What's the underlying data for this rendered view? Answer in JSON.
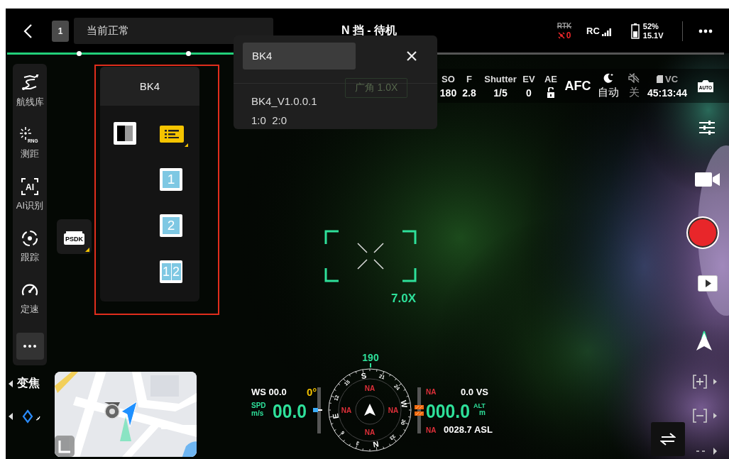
{
  "top_bar": {
    "channel": "1",
    "status": "当前正常",
    "mode": "N 挡 - 待机",
    "rtk": {
      "label": "RTK",
      "connected": false,
      "count": "0"
    },
    "rc": {
      "label": "RC"
    },
    "battery": {
      "percent": "52%",
      "voltage": "15.1V",
      "level": 0.52
    }
  },
  "mission_progress": {
    "level": 0.45
  },
  "sidebar": {
    "items": [
      {
        "kind": "route",
        "label": "航线库"
      },
      {
        "kind": "range",
        "label": "测距",
        "badge": "RNG"
      },
      {
        "kind": "ai",
        "label": "AI识别",
        "badge": "AI"
      },
      {
        "kind": "track",
        "label": "跟踪"
      },
      {
        "kind": "speed",
        "label": "定速"
      }
    ]
  },
  "psdk_button": {
    "label": "PSDK"
  },
  "bk_panel": {
    "title": "BK4",
    "options": [
      {
        "kind": "contrast",
        "selected": false
      },
      {
        "kind": "list",
        "selected": true
      },
      {
        "kind": "number",
        "labels": [
          "1"
        ],
        "selected": false
      },
      {
        "kind": "number",
        "labels": [
          "2"
        ],
        "selected": false
      },
      {
        "kind": "number",
        "labels": [
          "1",
          "2"
        ],
        "selected": false
      }
    ]
  },
  "popup": {
    "search_value": "BK4",
    "version": "BK4_V1.0.0.1",
    "channels": "1:0  2:0"
  },
  "lens_badge": "广角 1.0X",
  "camera_params": {
    "items": [
      {
        "kind": "text",
        "label": "SO",
        "value": "180"
      },
      {
        "kind": "text",
        "label": "F",
        "value": "2.8"
      },
      {
        "kind": "text",
        "label": "Shutter",
        "value": "1/5"
      },
      {
        "kind": "text",
        "label": "EV",
        "value": "0"
      },
      {
        "kind": "lock",
        "label": "AE",
        "locked": false
      }
    ],
    "focus": "AFC",
    "night": "自动",
    "mute": "关",
    "storage": {
      "label": "VC",
      "time": "45:13:44"
    },
    "camera_mode": "AUTO"
  },
  "zoom_reading": "7.0X",
  "flight": {
    "heading": "190",
    "wind": "WS 00.0",
    "gimbal": "0°",
    "speed_label": "SPD",
    "speed_unit": "m/s",
    "speed": "00.0",
    "compass_labels": [
      "S",
      "21",
      "24",
      "W",
      "30",
      "33",
      "N",
      "3",
      "6",
      "E",
      "12",
      "15"
    ],
    "compass_readings": [
      "NA",
      "NA",
      "NA",
      "NA"
    ],
    "vs_status": "NA",
    "vertical_speed": "0.0 VS",
    "altitude": "000.0",
    "alt_label": "ALT",
    "alt_unit": "m",
    "asl_status": "NA",
    "asl": "0028.7 ASL"
  },
  "bottom_left": {
    "zoom_label": "变焦"
  }
}
